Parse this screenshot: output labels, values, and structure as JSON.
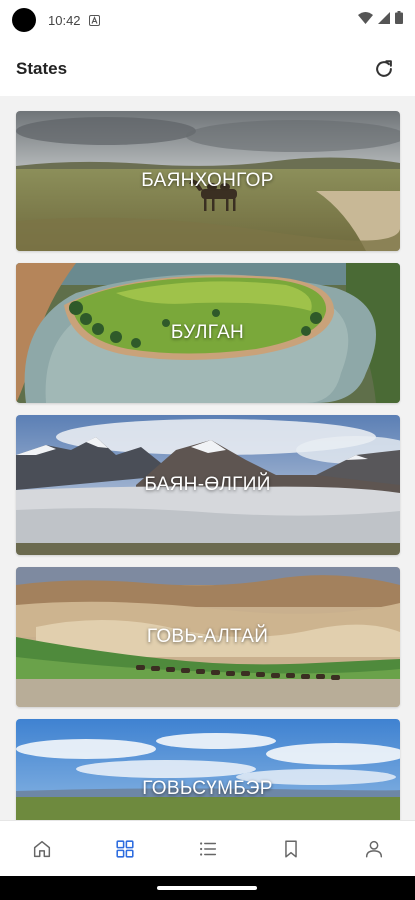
{
  "status_bar": {
    "time": "10:42"
  },
  "app_bar": {
    "title": "States"
  },
  "states": [
    {
      "name": "БАЯНХОНГОР"
    },
    {
      "name": "БУЛГАН"
    },
    {
      "name": "БАЯН-ӨЛГИЙ"
    },
    {
      "name": "ГОВЬ-АЛТАЙ"
    },
    {
      "name": "ГОВЬСҮМБЭР"
    }
  ],
  "bottom_nav": {
    "items": [
      "home-icon",
      "grid-icon",
      "list-icon",
      "bookmark-icon",
      "profile-icon"
    ],
    "active_index": 1
  },
  "colors": {
    "accent": "#2d6cdf",
    "inactive_icon": "#666666"
  }
}
